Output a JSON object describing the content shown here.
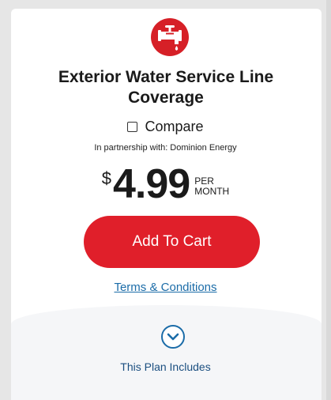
{
  "plan": {
    "icon": "water-faucet-icon",
    "title": "Exterior Water Service Line Coverage",
    "compare_label": "Compare",
    "partnership": "In partnership with: Dominion Energy",
    "price": {
      "currency": "$",
      "amount": "4.99",
      "per": "PER",
      "period": "MONTH"
    },
    "add_to_cart_label": "Add To Cart",
    "terms_label": "Terms & Conditions",
    "expand_icon": "chevron-down-circle-icon",
    "includes_label": "This Plan Includes"
  },
  "colors": {
    "brand_red": "#e01f2a",
    "link_blue": "#1b6ca8",
    "text_dark": "#1a1a1a"
  }
}
